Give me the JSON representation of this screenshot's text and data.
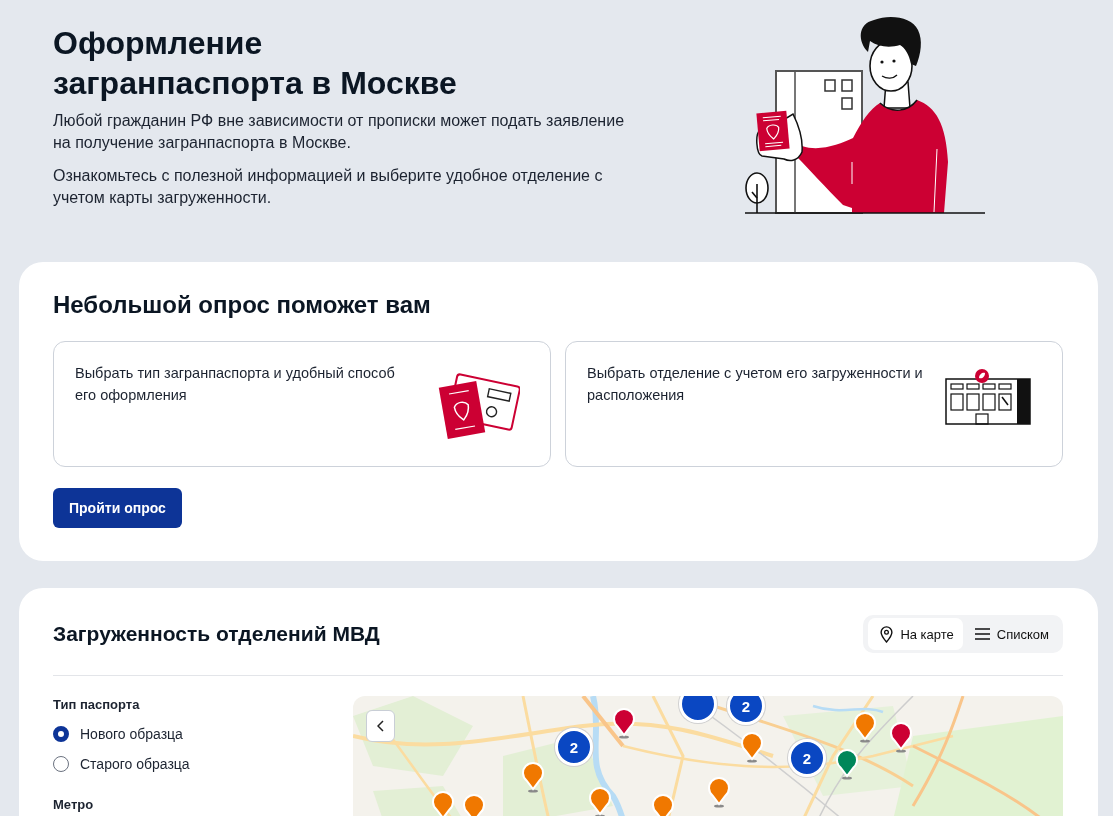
{
  "header": {
    "title": "Оформление загранпаспорта в Москве",
    "paragraphs": [
      "Любой гражданин РФ вне зависимости от прописки может подать заявление на получение загранпаспорта в Москве.",
      "Ознакомьтесь с полезной информацией и выберите удобное отделение с учетом карты загруженности."
    ]
  },
  "survey": {
    "title": "Небольшой опрос поможет вам",
    "options": [
      {
        "kind": "passport",
        "text": "Выбрать тип загранпаспорта и удобный способ его оформления"
      },
      {
        "kind": "office",
        "text": "Выбрать отделение с учетом его загруженности и расположения"
      }
    ],
    "button": "Пройти опрос"
  },
  "workload": {
    "title": "Загруженность отделений МВД",
    "view_tabs": [
      {
        "kind": "map",
        "label": "На карте",
        "selected": true
      },
      {
        "kind": "list",
        "label": "Списком",
        "selected": false
      }
    ],
    "filters": {
      "passport_type": {
        "label": "Тип паспорта",
        "options": [
          {
            "label": "Нового образца",
            "selected": true
          },
          {
            "label": "Старого образца",
            "selected": false
          }
        ]
      },
      "metro": {
        "label": "Метро"
      }
    },
    "map": {
      "markers": [
        {
          "kind": "pin",
          "color": "#cc0033"
        },
        {
          "kind": "cluster",
          "color": "#0a47c2",
          "count": "2"
        },
        {
          "kind": "cluster",
          "color": "#0a47c2"
        },
        {
          "kind": "cluster",
          "color": "#0a47c2",
          "count": "2"
        },
        {
          "kind": "pin",
          "color": "#f07800"
        },
        {
          "kind": "cluster",
          "color": "#0a47c2",
          "count": "2"
        },
        {
          "kind": "pin",
          "color": "#00875a"
        },
        {
          "kind": "pin",
          "color": "#f07800"
        },
        {
          "kind": "pin",
          "color": "#cc0033"
        },
        {
          "kind": "pin",
          "color": "#f07800"
        },
        {
          "kind": "pin",
          "color": "#f07800"
        },
        {
          "kind": "pin",
          "color": "#f07800"
        },
        {
          "kind": "pin",
          "color": "#f07800"
        },
        {
          "kind": "pin",
          "color": "#f07800"
        },
        {
          "kind": "pin",
          "color": "#f07800"
        }
      ]
    }
  }
}
